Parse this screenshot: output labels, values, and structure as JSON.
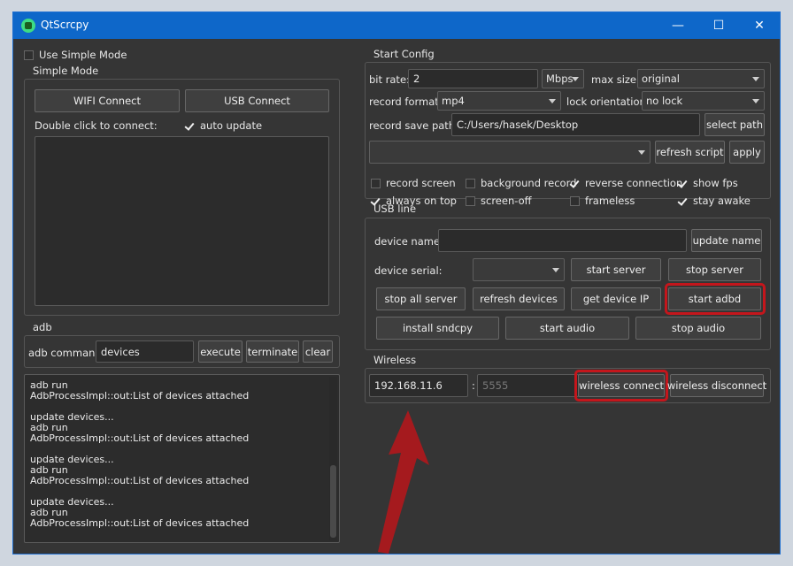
{
  "window": {
    "title": "QtScrcpy",
    "minimize": "—",
    "maximize": "☐",
    "close": "✕"
  },
  "left": {
    "use_simple_mode": {
      "label": "Use Simple Mode",
      "checked": false
    },
    "simple_mode": {
      "title": "Simple Mode",
      "wifi_connect": "WIFI Connect",
      "usb_connect": "USB Connect",
      "double_click_label": "Double click to connect:",
      "auto_update": {
        "label": "auto update",
        "checked": true
      }
    },
    "adb": {
      "title": "adb",
      "command_label": "adb command:",
      "command_value": "devices",
      "execute": "execute",
      "terminate": "terminate",
      "clear": "clear",
      "log": [
        "adb run",
        "AdbProcessImpl::out:List of devices attached",
        "",
        "update devices...",
        "adb run",
        "AdbProcessImpl::out:List of devices attached",
        "",
        "update devices...",
        "adb run",
        "AdbProcessImpl::out:List of devices attached",
        "",
        "update devices...",
        "adb run",
        "AdbProcessImpl::out:List of devices attached"
      ]
    }
  },
  "start_config": {
    "title": "Start Config",
    "bit_rate_label": "bit rate:",
    "bit_rate_value": "2",
    "bit_rate_unit": "Mbps",
    "max_size_label": "max size:",
    "max_size_value": "original",
    "record_format_label": "record format:",
    "record_format_value": "mp4",
    "lock_orientation_label": "lock orientation:",
    "lock_orientation_value": "no lock",
    "record_save_path_label": "record save path:",
    "record_save_path_value": "C:/Users/hasek/Desktop",
    "select_path": "select path",
    "script_value": "",
    "refresh_script": "refresh script",
    "apply": "apply",
    "options": {
      "record_screen": {
        "label": "record screen",
        "checked": false
      },
      "background_record": {
        "label": "background record",
        "checked": false
      },
      "reverse_connection": {
        "label": "reverse connection",
        "checked": true
      },
      "show_fps": {
        "label": "show fps",
        "checked": true
      },
      "always_on_top": {
        "label": "always on top",
        "checked": true
      },
      "screen_off": {
        "label": "screen-off",
        "checked": false
      },
      "frameless": {
        "label": "frameless",
        "checked": false
      },
      "stay_awake": {
        "label": "stay awake",
        "checked": true
      }
    }
  },
  "usb_line": {
    "title": "USB line",
    "device_name_label": "device name:",
    "device_name_value": "",
    "update_name": "update name",
    "device_serial_label": "device serial:",
    "device_serial_value": "",
    "start_server": "start server",
    "stop_server": "stop server",
    "stop_all_server": "stop all server",
    "refresh_devices": "refresh devices",
    "get_device_ip": "get device IP",
    "start_adbd": "start adbd",
    "install_sndcpy": "install sndcpy",
    "start_audio": "start audio",
    "stop_audio": "stop audio"
  },
  "wireless": {
    "title": "Wireless",
    "ip_value": "192.168.11.6",
    "separator": ":",
    "port_placeholder": "5555",
    "wireless_connect": "wireless connect",
    "wireless_disconnect": "wireless disconnect"
  },
  "annotation": {
    "highlight_color": "#c4161c",
    "arrow_color": "#a51a1e"
  }
}
